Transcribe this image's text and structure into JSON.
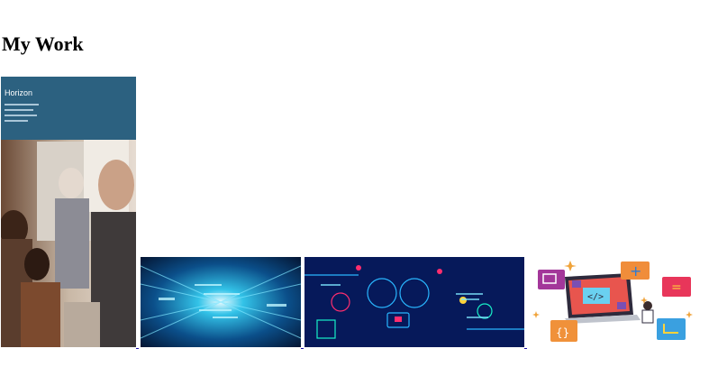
{
  "page": {
    "title": "My Work"
  },
  "gallery": {
    "items": [
      {
        "name": "work-1",
        "alt": "Team meeting photo with Horizon brochure header",
        "header_text": "Horizon"
      },
      {
        "name": "work-2",
        "alt": "Blue futuristic data tunnel"
      },
      {
        "name": "work-3",
        "alt": "Neon illustration of two kids coding"
      },
      {
        "name": "work-4",
        "alt": "Laptop with code brackets and app icons illustration"
      }
    ]
  },
  "colors": {
    "link": "#1a0dab",
    "brochure_blue": "#2c6180"
  }
}
